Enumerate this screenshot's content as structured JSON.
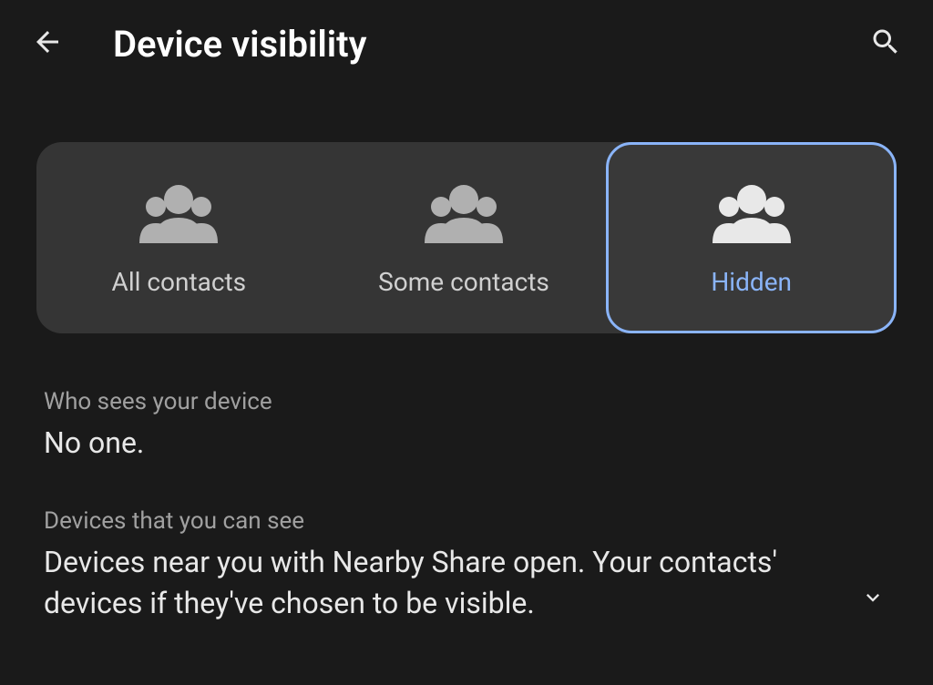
{
  "header": {
    "title": "Device visibility"
  },
  "tabs": {
    "items": [
      {
        "label": "All contacts"
      },
      {
        "label": "Some contacts"
      },
      {
        "label": "Hidden"
      }
    ]
  },
  "sections": {
    "who_sees": {
      "label": "Who sees your device",
      "value": "No one."
    },
    "devices_see": {
      "label": "Devices that you can see",
      "value": "Devices near you with Nearby Share open. Your contacts' devices if they've chosen to be visible."
    }
  },
  "colors": {
    "accent": "#8ab4f8",
    "background": "#1a1a1a",
    "card": "#353535"
  }
}
